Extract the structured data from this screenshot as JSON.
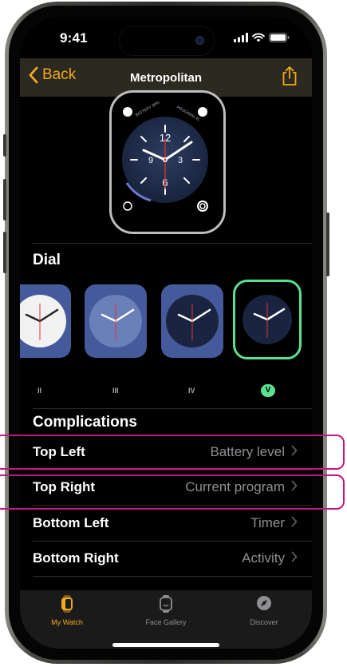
{
  "status": {
    "time": "9:41"
  },
  "nav": {
    "back_label": "Back",
    "title": "Metropolitan"
  },
  "watch_face": {
    "corner_tl_text": "BATTERY 80%",
    "corner_tr_text": "PROGRAM 41",
    "numeral_top": "12",
    "numeral_bottom": "6"
  },
  "dial": {
    "title": "Dial",
    "options": [
      {
        "label": "II",
        "style": "light"
      },
      {
        "label": "III",
        "style": "blue"
      },
      {
        "label": "IV",
        "style": "navy"
      },
      {
        "label": "V",
        "style": "navy",
        "selected": true
      }
    ],
    "selected": "V"
  },
  "complications": {
    "title": "Complications",
    "rows": [
      {
        "label": "Top Left",
        "value": "Battery level"
      },
      {
        "label": "Top Right",
        "value": "Current program"
      },
      {
        "label": "Bottom Left",
        "value": "Timer"
      },
      {
        "label": "Bottom Right",
        "value": "Activity"
      }
    ]
  },
  "tabbar": {
    "items": [
      {
        "label": "My Watch",
        "active": true
      },
      {
        "label": "Face Gallery",
        "active": false
      },
      {
        "label": "Discover",
        "active": false
      }
    ]
  },
  "colors": {
    "accent": "#f2a81d",
    "selection": "#5be08f",
    "highlight_annotation": "#c2177e",
    "secondary_text": "#8e8e93"
  }
}
